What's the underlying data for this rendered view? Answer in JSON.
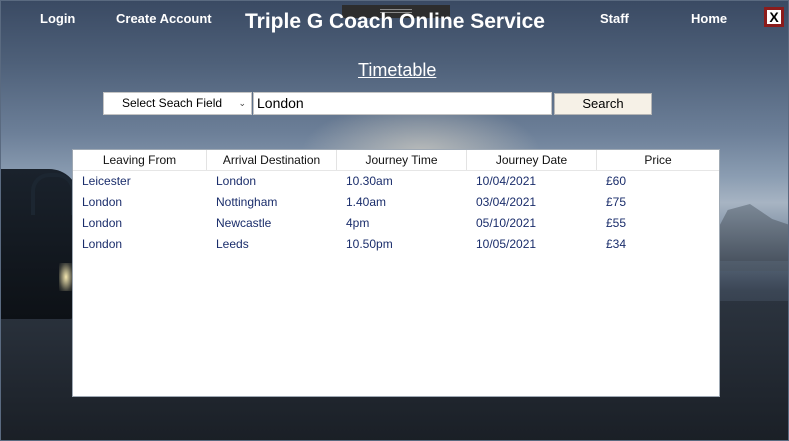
{
  "nav": {
    "login": "Login",
    "create_account": "Create Account",
    "staff": "Staff",
    "home": "Home",
    "close": "X"
  },
  "app_title": "Triple G Coach Online Service",
  "page_heading": "Timetable",
  "search": {
    "field_select_value": "Select Seach Field",
    "query_value": "London",
    "button_label": "Search"
  },
  "table": {
    "columns": [
      "Leaving From",
      "Arrival Destination",
      "Journey Time",
      "Journey Date",
      "Price"
    ],
    "rows": [
      [
        "Leicester",
        "London",
        "10.30am",
        "10/04/2021",
        "£60"
      ],
      [
        "London",
        "Nottingham",
        "1.40am",
        "03/04/2021",
        "£75"
      ],
      [
        "London",
        "Newcastle",
        "4pm",
        "05/10/2021",
        "£55"
      ],
      [
        "London",
        "Leeds",
        "10.50pm",
        "10/05/2021",
        "£34"
      ]
    ]
  },
  "colors": {
    "close_border": "#8b1c1c",
    "cell_text": "#1a2d6b",
    "search_button_bg": "#f6f1e7"
  }
}
